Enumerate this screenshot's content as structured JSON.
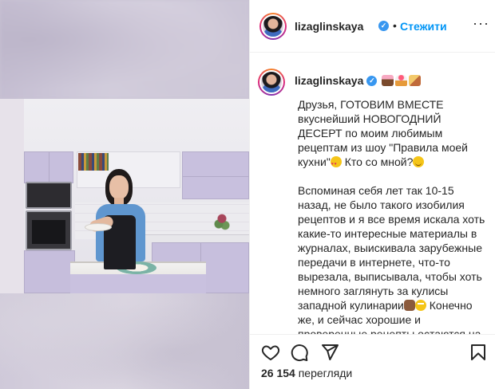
{
  "post": {
    "username": "lizaglinskaya",
    "verified_mark": "✓",
    "follow_label": "Стежити",
    "separator": "•",
    "more_label": "···",
    "caption_header_emojis": [
      "cake-icon",
      "cupcake-icon",
      "pie-slice-icon"
    ],
    "caption": {
      "p1_a": "Друзья, ГОТОВИМ ВМЕСТЕ вкуснейший НОВОГОДНИЙ ДЕСЕРТ по моим любимым рецептам из шоу \"Правила моей кухни\"",
      "p1_b": " Кто со мной?",
      "p2_a": "Вспоминая себя лет так 10-15 назад, не было такого изобилия рецептов и я все время искала хоть какие-то интересные материалы в журналах, выискивала зарубежные передачи в интернете, что-то вырезала, выписывала, чтобы хоть немного заглянуть за кулисы западной кулинарии",
      "p2_b": " Конечно же, и сейчас хорошие и проверенные рецепты остаются на вес золота, но все же как-то доступнее что ли"
    },
    "views_count": "26 154",
    "views_label": "перегляди"
  },
  "icons": {
    "like": "heart-icon",
    "comment": "comment-icon",
    "share": "send-icon",
    "save": "bookmark-icon"
  },
  "colors": {
    "link_blue": "#0095f6",
    "verified_blue": "#3897f0",
    "text": "#262626",
    "divider": "#efefef"
  }
}
